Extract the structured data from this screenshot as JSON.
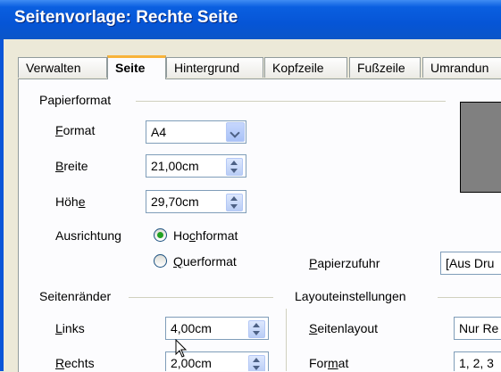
{
  "window": {
    "title": "Seitenvorlage: Rechte Seite"
  },
  "tabs": [
    {
      "label": "Verwalten"
    },
    {
      "label": "Seite"
    },
    {
      "label": "Hintergrund"
    },
    {
      "label": "Kopfzeile"
    },
    {
      "label": "Fußzeile"
    },
    {
      "label": "Umrandun"
    }
  ],
  "paper": {
    "group_label": "Papierformat",
    "format_label_ul": "F",
    "format_label_rest": "ormat",
    "format_value": "A4",
    "width_label_ul": "B",
    "width_label_rest": "reite",
    "width_value": "21,00cm",
    "height_label_pre": "Höh",
    "height_label_ul": "e",
    "height_value": "29,70cm",
    "orientation_label": "Ausrichtung",
    "portrait_pre": "Ho",
    "portrait_ul": "c",
    "portrait_rest": "hformat",
    "landscape_ul": "Q",
    "landscape_rest": "uerformat",
    "tray_label_ul": "P",
    "tray_label_rest": "apierzufuhr",
    "tray_value": "[Aus Dru"
  },
  "margins": {
    "group_label": "Seitenränder",
    "left_label_ul": "L",
    "left_label_rest": "inks",
    "left_value": "4,00cm",
    "right_label_ul": "R",
    "right_label_rest": "echts",
    "right_value": "2,00cm"
  },
  "layout": {
    "group_label": "Layouteinstellungen",
    "page_layout_label_ul": "S",
    "page_layout_label_rest": "eitenlayout",
    "page_layout_value": "Nur Re",
    "format_label_pre": "For",
    "format_label_ul": "m",
    "format_label_rest": "at",
    "format_value": "1, 2, 3"
  }
}
